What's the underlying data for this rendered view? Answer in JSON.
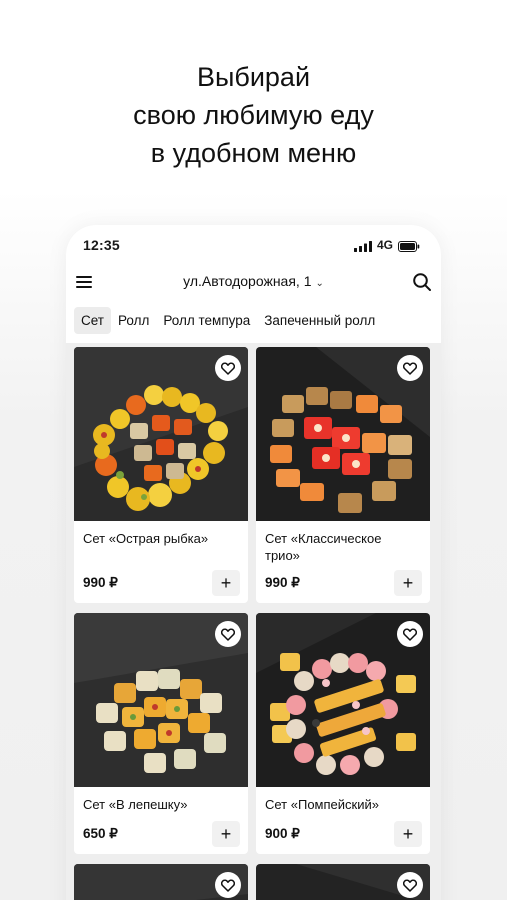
{
  "headline": {
    "line1": "Выбирай",
    "line2": "свою любимую еду",
    "line3": "в удобном меню"
  },
  "status_bar": {
    "time": "12:35",
    "network": "4G",
    "icons": [
      "signal-icon",
      "battery-icon"
    ]
  },
  "header": {
    "menu_icon": "hamburger-menu-icon",
    "address": "ул.Автодорожная, 1",
    "address_chevron": "⌄",
    "search_icon": "search-icon"
  },
  "categories": [
    {
      "label": "Сет",
      "active": true
    },
    {
      "label": "Ролл",
      "active": false
    },
    {
      "label": "Ролл темпура",
      "active": false
    },
    {
      "label": "Запеченный ролл",
      "active": false
    }
  ],
  "products": [
    {
      "name": "Сет «Острая рыбка»",
      "price": "990 ₽",
      "add": "+"
    },
    {
      "name": "Сет «Классическое трио»",
      "price": "990 ₽",
      "add": "+"
    },
    {
      "name": "Сет «В лепешку»",
      "price": "650 ₽",
      "add": "+"
    },
    {
      "name": "Сет «Помпейский»",
      "price": "900 ₽",
      "add": "+"
    }
  ],
  "colors": {
    "background": "#f2f2f2",
    "card": "#ffffff",
    "active_tab": "#ececec",
    "text": "#111111"
  }
}
